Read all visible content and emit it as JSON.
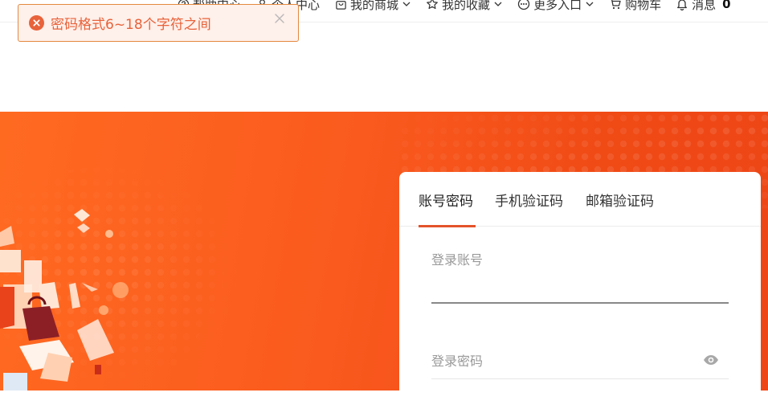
{
  "toast": {
    "message": "密码格式6~18个字符之间",
    "type": "error"
  },
  "nav": {
    "items": [
      {
        "label": "帮助中心",
        "icon": "help-icon"
      },
      {
        "label": "个人中心",
        "icon": "user-icon"
      },
      {
        "label": "我的商城",
        "icon": "bag-icon",
        "dropdown": true
      },
      {
        "label": "我的收藏",
        "icon": "star-icon",
        "dropdown": true
      },
      {
        "label": "更多入口",
        "icon": "more-icon",
        "dropdown": true
      },
      {
        "label": "购物车",
        "icon": "cart-icon"
      },
      {
        "label": "消息",
        "icon": "bell-icon",
        "count": "0"
      }
    ]
  },
  "login": {
    "tabs": [
      {
        "label": "账号密码",
        "active": true
      },
      {
        "label": "手机验证码",
        "active": false
      },
      {
        "label": "邮箱验证码",
        "active": false
      }
    ],
    "account_label": "登录账号",
    "password_label": "登录密码"
  },
  "colors": {
    "accent": "#e4522a",
    "error": "#e8623a",
    "hero_start": "#ff6a21",
    "hero_end": "#ee4617"
  }
}
